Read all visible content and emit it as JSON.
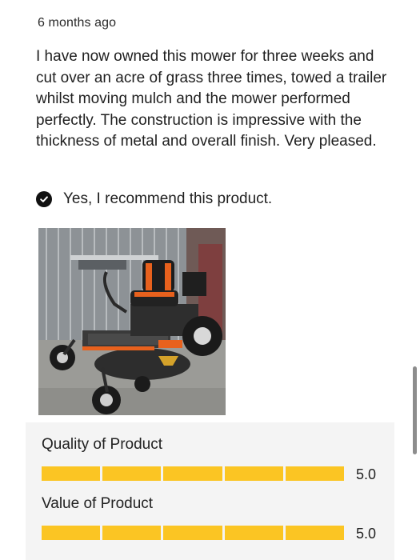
{
  "review": {
    "timestamp": "6 months ago",
    "body": "I have now owned this mower for three weeks and cut over an acre of grass three times, towed a trailer whilst moving mulch and the mower performed perfectly. The construction is impressive with the thickness of metal and overall finish. Very pleased.",
    "recommend_text": "Yes, I recommend this product.",
    "recommend_icon": "check-circle-icon",
    "photo_alt": "Zero-turn mower photo"
  },
  "ratings": [
    {
      "label": "Quality of Product",
      "value": "5.0",
      "score": 5,
      "max": 5
    },
    {
      "label": "Value of Product",
      "value": "5.0",
      "score": 5,
      "max": 5
    }
  ],
  "colors": {
    "star_bar": "#fbc523",
    "panel_bg": "#f4f4f4",
    "mower_orange": "#e8611d"
  }
}
